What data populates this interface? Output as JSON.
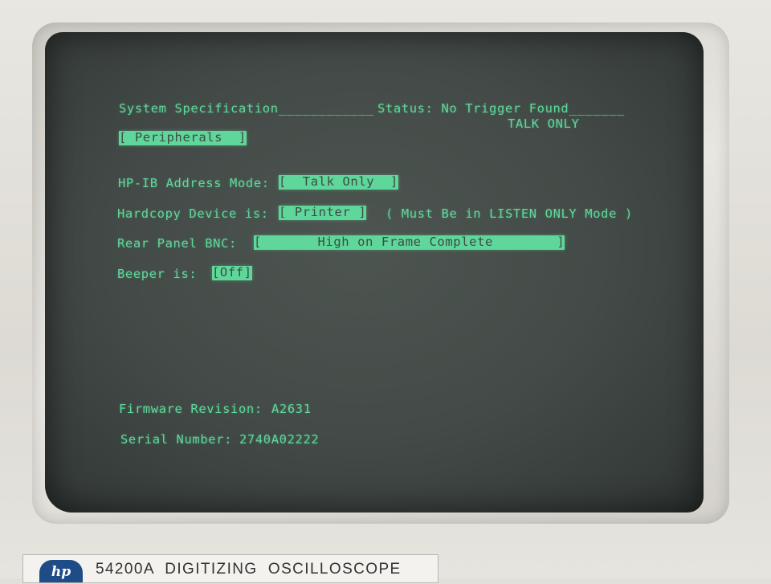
{
  "screen": {
    "header_left": "System Specification____________",
    "header_status": "Status: No Trigger Found_______",
    "mode_indicator": "TALK ONLY",
    "menu_tab": "[ Peripherals  ]",
    "hpib_label": "HP-IB Address Mode:",
    "hpib_value": "[  Talk Only  ]",
    "hardcopy_label": "Hardcopy Device is:",
    "hardcopy_value": "[ Printer ]",
    "hardcopy_note": "( Must Be in LISTEN ONLY Mode )",
    "bnc_label": "Rear Panel BNC:",
    "bnc_value": "[       High on Frame Complete        ]",
    "beeper_label": "Beeper is:",
    "beeper_value": "[Off]",
    "firmware_label": "Firmware Revision:",
    "firmware_value": "A2631",
    "serial_label": "Serial Number:",
    "serial_value": "2740A02222"
  },
  "nameplate": {
    "brand_logo": "hp",
    "model_text": "54200A  DIGITIZING  OSCILLOSCOPE"
  },
  "colors": {
    "phosphor": "#5fd79a",
    "screen": "#434a47",
    "bezel": "#e2e0da"
  }
}
